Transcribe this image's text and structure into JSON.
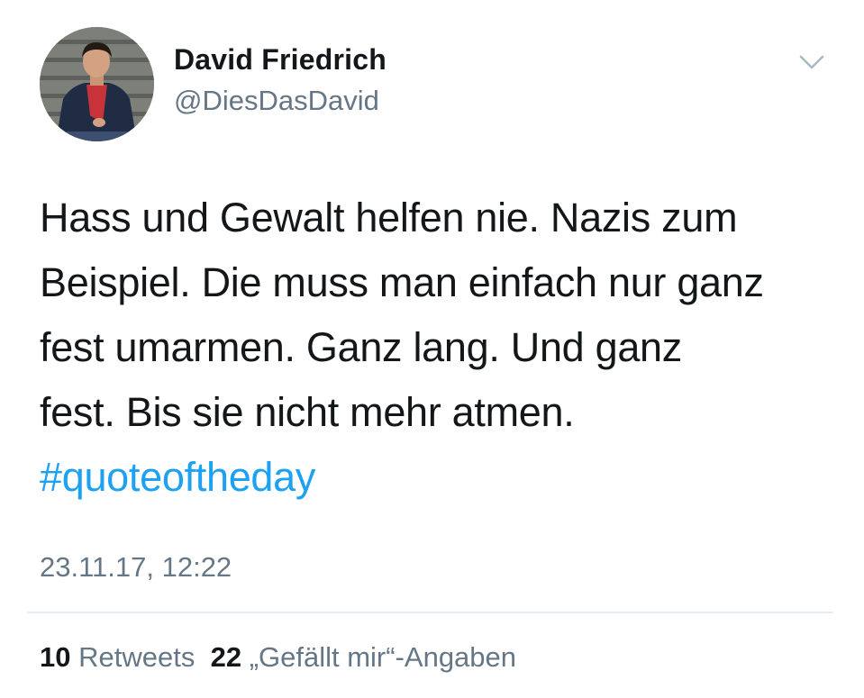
{
  "user": {
    "display_name": "David Friedrich",
    "handle": "@DiesDasDavid",
    "avatar_icon": "profile-photo"
  },
  "menu": {
    "icon": "chevron-down-icon"
  },
  "tweet": {
    "lines": [
      "Hass und Gewalt helfen nie. Nazis zum",
      "Beispiel. Die muss man einfach nur ganz",
      "fest umarmen. Ganz lang. Und ganz",
      "fest. Bis sie nicht mehr atmen."
    ],
    "hashtag": "#quoteoftheday",
    "timestamp": "23.11.17, 12:22"
  },
  "stats": {
    "retweets_count": "10",
    "retweets_label": "Retweets",
    "likes_count": "22",
    "likes_label": "„Gefällt mir“-Angaben"
  },
  "colors": {
    "text": "#14171a",
    "secondary": "#657786",
    "link": "#1da1f2",
    "divider": "#e6ecf0"
  }
}
